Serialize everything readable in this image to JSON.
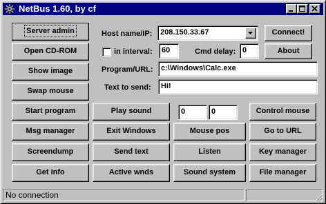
{
  "window": {
    "title": "NetBus 1.60, by cf",
    "icons": {
      "app": "netbus-gear-icon",
      "minimize": "minimize-icon",
      "maximize": "maximize-icon",
      "close": "close-icon"
    }
  },
  "connection": {
    "host_label": "Host name/IP:",
    "host_value": "208.150.33.67",
    "connect_label": "Connect!",
    "interval_label": "in interval:",
    "interval_checked": false,
    "interval_value": "60",
    "cmd_delay_label": "Cmd delay:",
    "cmd_delay_value": "0",
    "about_label": "About",
    "program_label": "Program/URL:",
    "program_value": "c:\\Windows\\Calc.exe",
    "text_label": "Text to send:",
    "text_value": "Hi!"
  },
  "left_buttons": {
    "server_admin": "Server admin",
    "open_cdrom": "Open CD-ROM",
    "show_image": "Show image",
    "swap_mouse": "Swap mouse"
  },
  "grid": {
    "start_program": "Start program",
    "play_sound": "Play sound",
    "coord_x": "0",
    "coord_y": "0",
    "control_mouse": "Control mouse",
    "msg_manager": "Msg manager",
    "exit_windows": "Exit Windows",
    "mouse_pos": "Mouse pos",
    "go_to_url": "Go to URL",
    "screendump": "Screendump",
    "send_text": "Send text",
    "listen": "Listen",
    "key_manager": "Key manager",
    "get_info": "Get info",
    "active_wnds": "Active wnds",
    "sound_system": "Sound system",
    "file_manager": "File manager"
  },
  "status": {
    "text": "No connection"
  }
}
